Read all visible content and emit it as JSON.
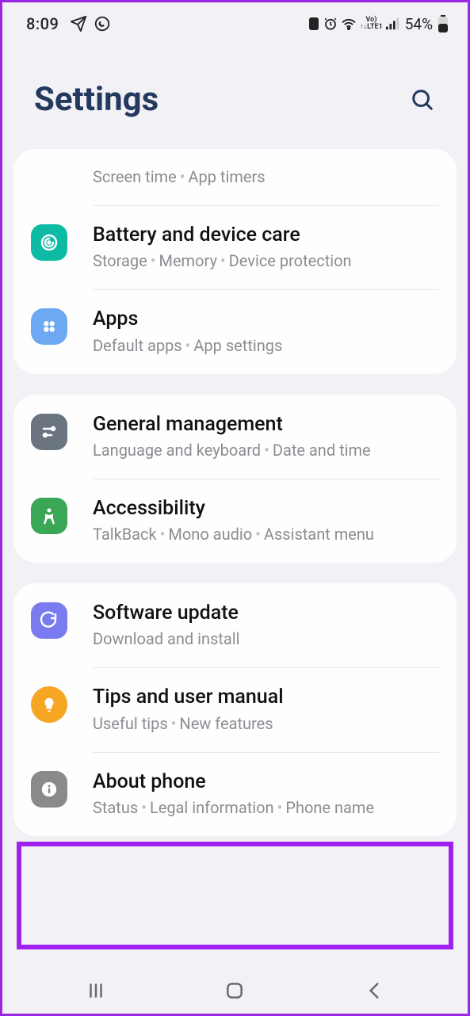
{
  "statusbar": {
    "time": "8:09",
    "lte_top": "Vo)",
    "lte_bottom": "↑↓LTE1",
    "battery": "54%"
  },
  "header": {
    "title": "Settings"
  },
  "items": {
    "digital": {
      "sub": [
        "Screen time",
        "App timers"
      ]
    },
    "battery": {
      "title": "Battery and device care",
      "sub": [
        "Storage",
        "Memory",
        "Device protection"
      ]
    },
    "apps": {
      "title": "Apps",
      "sub": [
        "Default apps",
        "App settings"
      ]
    },
    "general": {
      "title": "General management",
      "sub": [
        "Language and keyboard",
        "Date and time"
      ]
    },
    "access": {
      "title": "Accessibility",
      "sub": [
        "TalkBack",
        "Mono audio",
        "Assistant menu"
      ]
    },
    "update": {
      "title": "Software update",
      "sub": [
        "Download and install"
      ]
    },
    "tips": {
      "title": "Tips and user manual",
      "sub": [
        "Useful tips",
        "New features"
      ]
    },
    "about": {
      "title": "About phone",
      "sub": [
        "Status",
        "Legal information",
        "Phone name"
      ]
    }
  }
}
